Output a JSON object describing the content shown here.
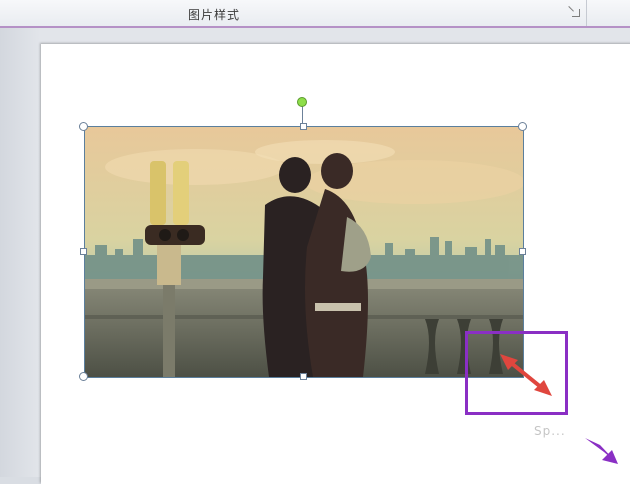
{
  "ribbon": {
    "group_label": "图片样式",
    "launcher_icon": "dialog-launcher-icon"
  },
  "selection": {
    "rotation_handle_color": "#8ede4a",
    "border_color": "#5b7f9d"
  },
  "annotation": {
    "box_color": "#8a2fc4",
    "arrow_color": "#e0463e",
    "cursor_arrow_color": "#8a2fc4"
  },
  "watermark": {
    "text": "Sp..."
  }
}
